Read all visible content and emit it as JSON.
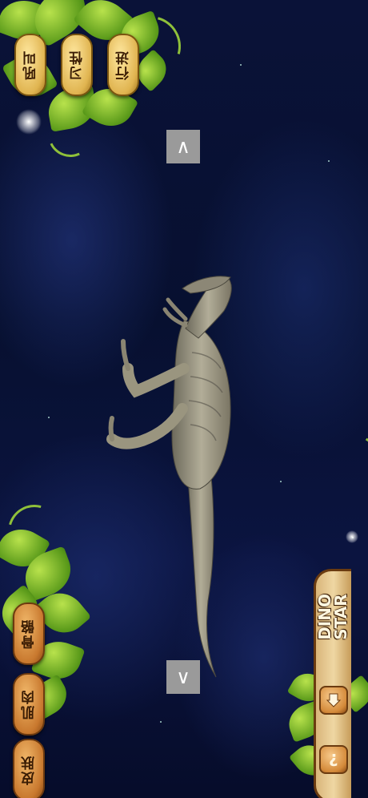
{
  "top_menu": {
    "walk_label": "行进",
    "habit_label": "习性",
    "roar_label": "吼叫"
  },
  "bottom_menu": {
    "skeleton_label": "骨骼",
    "muscle_label": "肌肉",
    "skin_label": "皮肤"
  },
  "navigation": {
    "up_label": "∧",
    "down_label": "∨"
  },
  "brand": {
    "title": "DINO\nSTAR"
  },
  "panel_icons": {
    "home_icon": "home-icon",
    "help_label": "?"
  },
  "colors": {
    "background": "#071030",
    "wood": "#c8782e",
    "leaf": "#7cb82a",
    "arrow_button": "#9a9a9a"
  }
}
